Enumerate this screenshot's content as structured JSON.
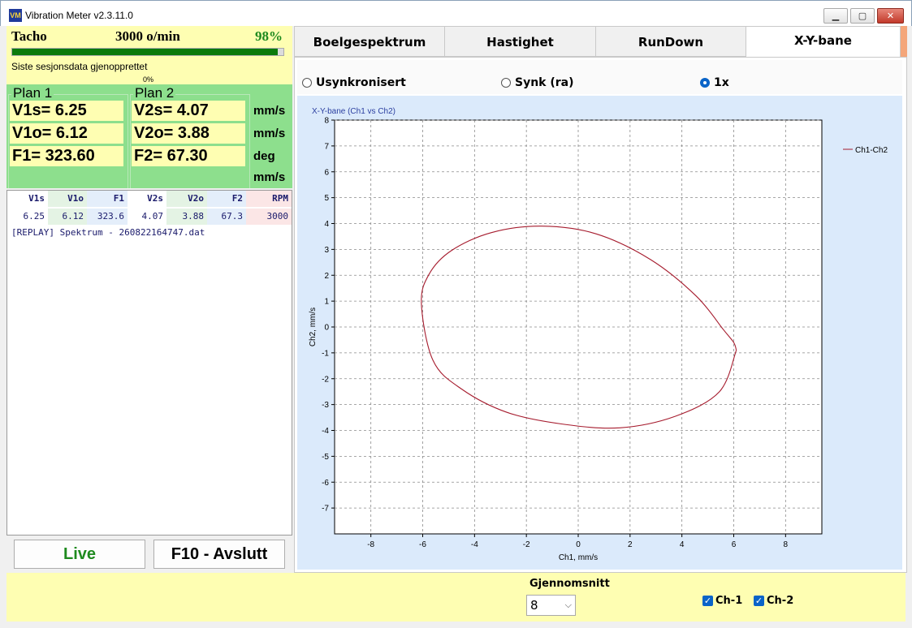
{
  "window": {
    "title": "Vibration Meter v2.3.11.0",
    "icon_text": "VM",
    "min_glyph": "▁",
    "max_glyph": "▢",
    "close_glyph": "✕"
  },
  "tacho": {
    "label": "Tacho",
    "rpm": "3000 o/min",
    "percent": "98%",
    "progress_fraction": 0.98,
    "status": "Siste sesjonsdata gjenopprettet",
    "status_percent": "0%"
  },
  "plan1": {
    "title": "Plan 1",
    "v1s": "V1s= 6.25",
    "v1o": "V1o= 6.12",
    "f1": "F1= 323.60"
  },
  "plan2": {
    "title": "Plan 2",
    "v2s": "V2s= 4.07",
    "v2o": "V2o= 3.88",
    "f2": "F2= 67.30"
  },
  "units": [
    "mm/s",
    "mm/s",
    "deg",
    "mm/s"
  ],
  "table": {
    "headers": [
      "V1s",
      "V1o",
      "F1",
      "V2s",
      "V2o",
      "F2",
      "RPM"
    ],
    "row": [
      "6.25",
      "6.12",
      "323.6",
      "4.07",
      "3.88",
      "67.3",
      "3000"
    ]
  },
  "log": "[REPLAY] Spektrum - 260822164747.dat",
  "buttons": {
    "live": "Live",
    "exit": "F10 - Avslutt"
  },
  "tabs": [
    "Boelgespektrum",
    "Hastighet",
    "RunDown",
    "X-Y-bane"
  ],
  "active_tab": 3,
  "radios": [
    {
      "label": "Usynkronisert",
      "checked": false
    },
    {
      "label": "Synk (ra)",
      "checked": false
    },
    {
      "label": "1x",
      "checked": true
    }
  ],
  "bottom": {
    "avg_label": "Gjennomsnitt",
    "avg_value": "8",
    "avg_arrow": "⌵",
    "ch1": "Ch-1",
    "ch2": "Ch-2",
    "check_glyph": "✓"
  },
  "chart_data": {
    "type": "line",
    "title": "X-Y-bane (Ch1 vs Ch2)",
    "xlabel": "Ch1, mm/s",
    "ylabel": "Ch2, mm/s",
    "xlim": [
      -9.4,
      9.4
    ],
    "ylim": [
      -8,
      8
    ],
    "xticks": [
      -8,
      -6,
      -4,
      -2,
      0,
      2,
      4,
      6,
      8
    ],
    "yticks": [
      -7,
      -6,
      -5,
      -4,
      -3,
      -2,
      -1,
      0,
      1,
      2,
      3,
      4,
      5,
      6,
      7,
      8
    ],
    "grid": true,
    "legend_position": "top-right",
    "line_color": "#a61c2e",
    "series": [
      {
        "name": "Ch1-Ch2",
        "x": [
          6.1,
          5.45,
          3.75,
          1.6,
          -0.65,
          -2.75,
          -4.5,
          -5.6,
          -6.05,
          -5.75,
          -4.9,
          -3.35,
          -1.4,
          0.7,
          2.8,
          4.55,
          5.6,
          6.0,
          6.1
        ],
        "y": [
          -0.9,
          -2.5,
          -3.45,
          -3.9,
          -3.75,
          -3.3,
          -2.4,
          -1.3,
          0.9,
          2.05,
          2.95,
          3.65,
          3.9,
          3.6,
          2.6,
          1.2,
          -0.1,
          -0.6,
          -0.9
        ]
      }
    ]
  }
}
